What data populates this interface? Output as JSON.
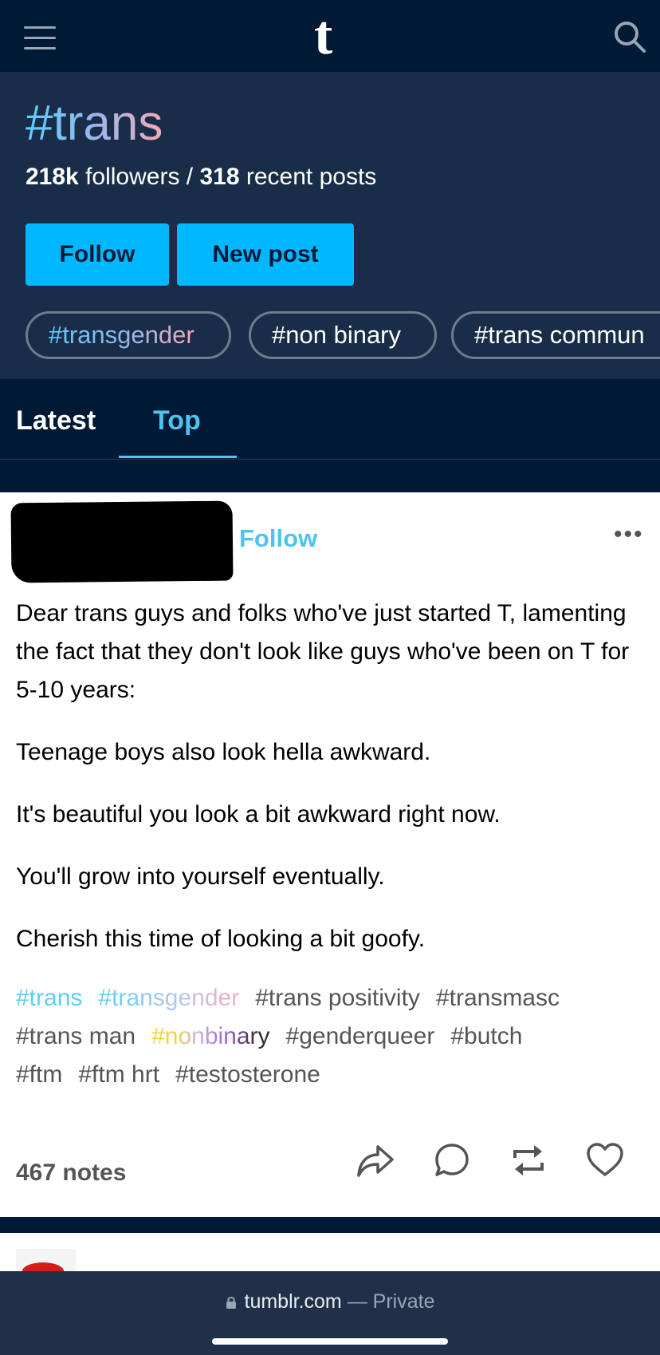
{
  "topbar": {
    "logo": "t",
    "menu_icon": "hamburger-menu-icon",
    "search_icon": "search-icon"
  },
  "tag_header": {
    "title": "#trans",
    "followers_count": "218k",
    "followers_label": " followers / ",
    "posts_count": "318",
    "posts_label": " recent posts",
    "follow_button": "Follow",
    "new_post_button": "New post",
    "related_tags": [
      "#transgender",
      "#non binary",
      "#trans commun"
    ]
  },
  "tabs": {
    "latest": "Latest",
    "top": "Top",
    "active": "Top"
  },
  "post": {
    "follow_label": "Follow",
    "more_label": "•••",
    "paragraphs": [
      "Dear trans guys and folks who've just started T, lamenting the fact that they don't look like guys who've been on T for 5-10 years:",
      "Teenage boys also look hella awkward.",
      "It's beautiful you look a bit awkward right now.",
      "You'll grow into yourself eventually.",
      "Cherish this time of looking a bit goofy."
    ],
    "tags": [
      "#trans",
      "#transgender",
      "#trans positivity",
      "#transmasc",
      "#trans man",
      "#nonbinary",
      "#genderqueer",
      "#butch",
      "#ftm",
      "#ftm hrt",
      "#testosterone"
    ],
    "notes": "467 notes",
    "actions": [
      "share-icon",
      "reply-icon",
      "reblog-icon",
      "like-icon"
    ]
  },
  "browser": {
    "domain": "tumblr.com",
    "separator": " — ",
    "private_label": "Private"
  },
  "colors": {
    "navy": "#001935",
    "header_bg": "#1a2d48",
    "accent_blue": "#00b8ff",
    "link_blue": "#4cc3f0",
    "trans_pink": "#f5a9b8",
    "trans_blue": "#5bcefa"
  }
}
